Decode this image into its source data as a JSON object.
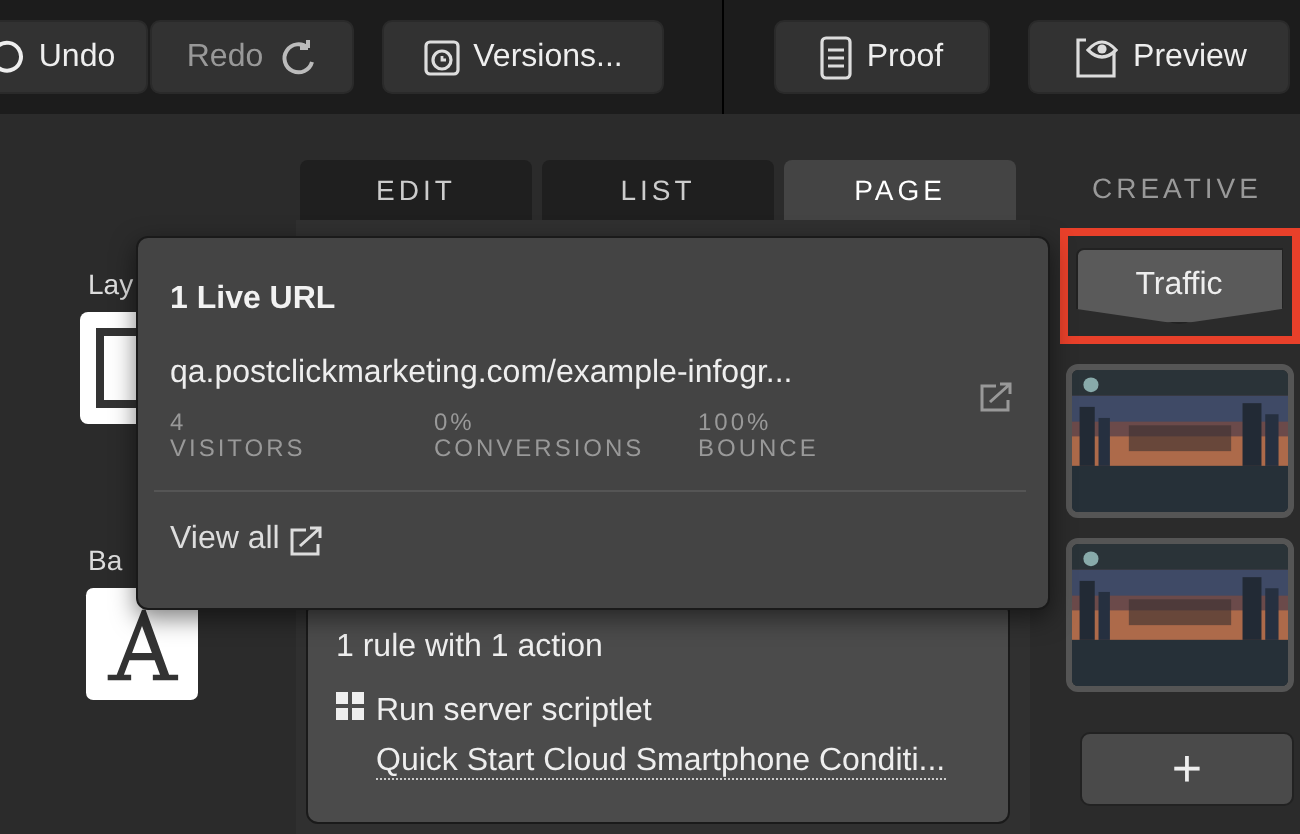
{
  "toolbar": {
    "left_buttons": [
      {
        "label": "Undo",
        "kind": "undo",
        "disabled": false
      },
      {
        "label": "Redo",
        "kind": "redo",
        "disabled": true
      },
      {
        "label": "Versions...",
        "kind": "versions",
        "disabled": false
      }
    ],
    "right_buttons": [
      {
        "label": "Proof",
        "kind": "proof"
      },
      {
        "label": "Preview",
        "kind": "preview"
      }
    ]
  },
  "left_panel": {
    "items": [
      {
        "label": "Lay",
        "kind": "layout"
      },
      {
        "label": "Ba",
        "kind": "font"
      }
    ]
  },
  "tabs": [
    {
      "label": "EDIT",
      "selected": false
    },
    {
      "label": "LIST",
      "selected": false
    },
    {
      "label": "PAGE",
      "selected": true
    }
  ],
  "rule_card": {
    "summary": "1 rule with 1 action",
    "action_text": "Run server scriptlet",
    "action_link": "Quick Start Cloud Smartphone Conditi..."
  },
  "right_panel": {
    "tab": "CREATIVE",
    "traffic_button": "Traffic",
    "highlighted": true,
    "add_button": "+"
  },
  "popover": {
    "title": "1 Live URL",
    "url": "qa.postclickmarketing.com/example-infogr...",
    "stats": [
      {
        "value": "4",
        "label": "VISITORS"
      },
      {
        "value": "0%",
        "label": "CONVERSIONS"
      },
      {
        "value": "100%",
        "label": "BOUNCE"
      }
    ],
    "view_all": "View all"
  }
}
